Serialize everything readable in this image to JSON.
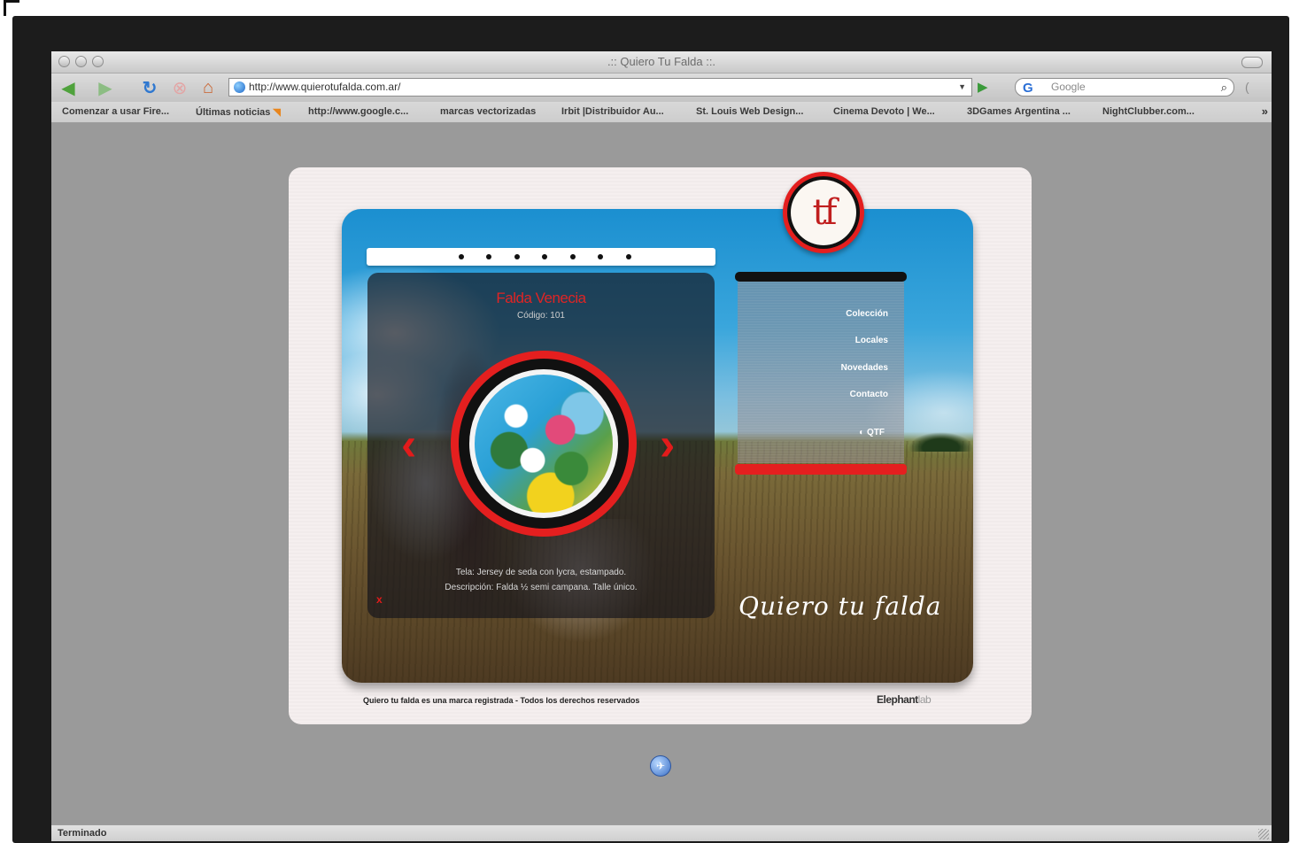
{
  "browser": {
    "window_title": ".:: Quiero Tu Falda ::.",
    "url": "http://www.quierotufalda.com.ar/",
    "search_placeholder": "Google",
    "status": "Terminado",
    "bookmarks": [
      "Comenzar a usar Fire...",
      "Últimas noticias",
      "http://www.google.c...",
      "marcas vectorizadas",
      "Irbit |Distribuidor Au...",
      "St. Louis Web Design...",
      "Cinema Devoto | We...",
      "3DGames Argentina ...",
      "NightClubber.com..."
    ],
    "bookmarks_more": "»",
    "icons": {
      "back": "back-arrow-icon",
      "forward": "forward-arrow-icon",
      "reload": "reload-icon",
      "stop": "stop-icon",
      "home": "home-icon",
      "search": "magnifier-icon"
    }
  },
  "site": {
    "logo_letters": "tf",
    "carousel_dots": 7,
    "product": {
      "name": "Falda Venecia",
      "code": "Código: 101",
      "desc_line1": "Tela: Jersey de seda con lycra, estampado.",
      "desc_line2": "Descripción: Falda ½ semi campana. Talle único.",
      "close": "x"
    },
    "nav_prev": "‹",
    "nav_next": "›",
    "menu": [
      "Colección",
      "Locales",
      "Novedades",
      "Contacto"
    ],
    "qtf_label": "QTF",
    "brand_script": "Quiero tu falda",
    "footer": "Quiero tu falda es una marca registrada - Todos los derechos reservados",
    "credit_main": "Elephant",
    "credit_light": "lab",
    "colors": {
      "accent_red": "#e41f1f",
      "card_bg": "#f5efef",
      "browser_bg": "#9a9a9a"
    }
  },
  "loader_glyph": "✈"
}
